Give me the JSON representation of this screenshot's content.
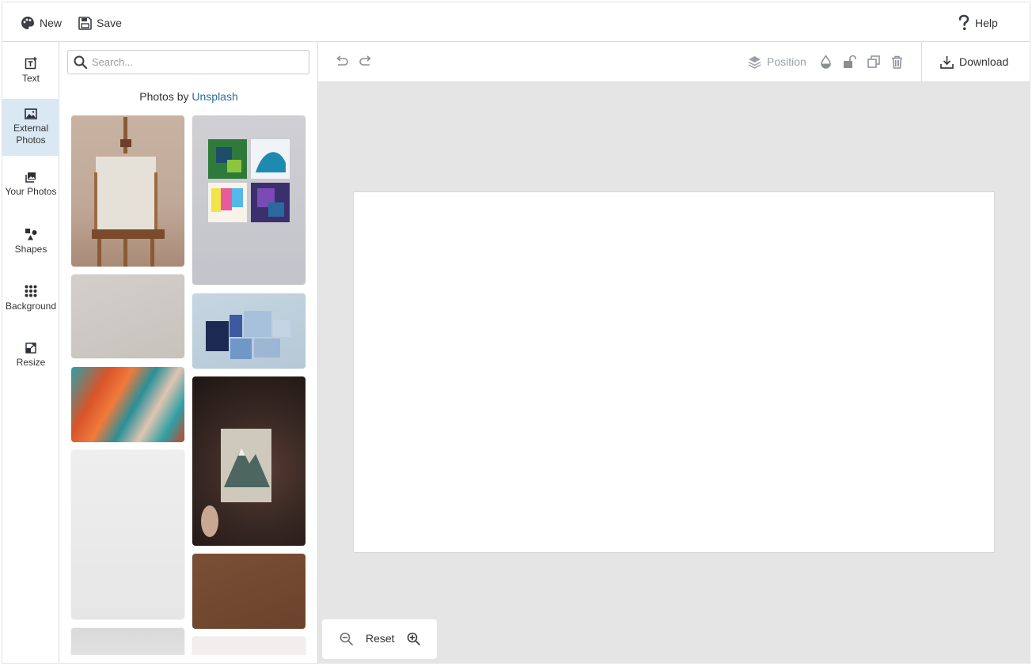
{
  "topbar": {
    "new_label": "New",
    "save_label": "Save",
    "help_label": "Help"
  },
  "nav": [
    {
      "label": "Text",
      "icon": "text-add-icon"
    },
    {
      "label": "External Photos",
      "icon": "image-icon",
      "active": true
    },
    {
      "label": "Your Photos",
      "icon": "photos-stack-icon"
    },
    {
      "label": "Shapes",
      "icon": "shapes-icon"
    },
    {
      "label": "Background",
      "icon": "dot-grid-icon"
    },
    {
      "label": "Resize",
      "icon": "resize-icon"
    }
  ],
  "panel": {
    "search_placeholder": "Search...",
    "credit_prefix": "Photos by ",
    "credit_link": "Unsplash"
  },
  "toolbar": {
    "position_label": "Position",
    "download_label": "Download"
  },
  "zoom": {
    "reset_label": "Reset"
  },
  "colors": {
    "active_nav": "#d9e8f3",
    "link": "#2a6d9c",
    "workspace": "#e5e5e5"
  }
}
